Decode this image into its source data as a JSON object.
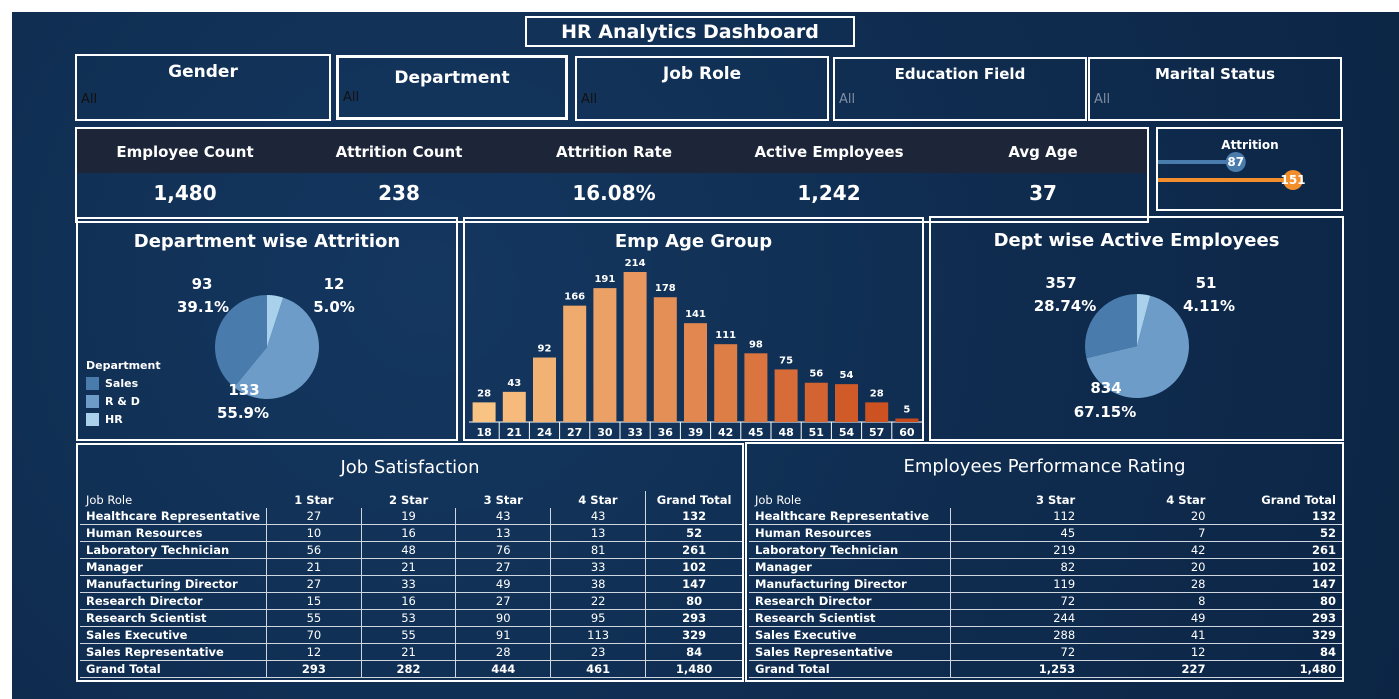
{
  "title": "HR Analytics Dashboard",
  "filters": [
    {
      "label": "Gender",
      "value": "All"
    },
    {
      "label": "Department",
      "value": "All"
    },
    {
      "label": "Job Role",
      "value": "All"
    },
    {
      "label": "Education Field",
      "value": "All"
    },
    {
      "label": "Marital Status",
      "value": "All"
    }
  ],
  "kpis": [
    {
      "label": "Employee Count",
      "value": "1,480"
    },
    {
      "label": "Attrition Count",
      "value": "238"
    },
    {
      "label": "Attrition Rate",
      "value": "16.08%"
    },
    {
      "label": "Active Employees",
      "value": "1,242"
    },
    {
      "label": "Avg Age",
      "value": "37"
    }
  ],
  "colors": {
    "sales": "#4a7bad",
    "rd": "#6d9cc9",
    "hr": "#a9d1ec",
    "attr_blue": "#4a7bad",
    "attr_orange": "#f28e2b",
    "bar_light": "#f9c483",
    "bar_dark": "#c9491a"
  },
  "chart_data": [
    {
      "type": "bar",
      "title": "Attrition",
      "categories": [
        "",
        ""
      ],
      "values": [
        87,
        151
      ],
      "value_labels": [
        "87",
        "151"
      ],
      "xlim": [
        0,
        151
      ]
    },
    {
      "type": "pie",
      "title": "Department wise Attrition",
      "legend_title": "Department",
      "legend_position": "left",
      "categories": [
        "Sales",
        "R & D",
        "HR"
      ],
      "values": [
        93,
        133,
        12
      ],
      "percent_labels": [
        "39.1%",
        "55.9%",
        "5.0%"
      ]
    },
    {
      "type": "bar",
      "title": "Emp Age Group",
      "categories": [
        "18",
        "21",
        "24",
        "27",
        "30",
        "33",
        "36",
        "39",
        "42",
        "45",
        "48",
        "51",
        "54",
        "57",
        "60"
      ],
      "values": [
        28,
        43,
        92,
        166,
        191,
        214,
        178,
        141,
        111,
        98,
        75,
        56,
        54,
        28,
        5
      ],
      "ylim": [
        0,
        214
      ]
    },
    {
      "type": "pie",
      "title": "Dept wise Active Employees",
      "categories": [
        "Sales",
        "R & D",
        "HR"
      ],
      "values": [
        357,
        834,
        51
      ],
      "percent_labels": [
        "28.74%",
        "67.15%",
        "4.11%"
      ]
    }
  ],
  "attrition_labels": {
    "v87": "87",
    "v151": "151"
  },
  "age_bar_labels": [
    "28",
    "43",
    "92",
    "166",
    "191",
    "214",
    "178",
    "141",
    "111",
    "98",
    "75",
    "56",
    "54",
    "28",
    "5"
  ],
  "dept_attrition_labels": {
    "sales_v": "93",
    "sales_p": "39.1%",
    "hr_v": "12",
    "hr_p": "5.0%",
    "rd_v": "133",
    "rd_p": "55.9%"
  },
  "legend_items": [
    "Sales",
    "R & D",
    "HR"
  ],
  "active_labels": {
    "sales_v": "357",
    "sales_p": "28.74%",
    "hr_v": "51",
    "hr_p": "4.11%",
    "rd_v": "834",
    "rd_p": "67.15%"
  },
  "job_satisfaction": {
    "title": "Job Satisfaction",
    "headers": [
      "Job Role",
      "1 Star",
      "2 Star",
      "3 Star",
      "4 Star",
      "Grand Total"
    ],
    "rows": [
      [
        "Healthcare Representative",
        "27",
        "19",
        "43",
        "43",
        "132"
      ],
      [
        "Human Resources",
        "10",
        "16",
        "13",
        "13",
        "52"
      ],
      [
        "Laboratory Technician",
        "56",
        "48",
        "76",
        "81",
        "261"
      ],
      [
        "Manager",
        "21",
        "21",
        "27",
        "33",
        "102"
      ],
      [
        "Manufacturing Director",
        "27",
        "33",
        "49",
        "38",
        "147"
      ],
      [
        "Research Director",
        "15",
        "16",
        "27",
        "22",
        "80"
      ],
      [
        "Research Scientist",
        "55",
        "53",
        "90",
        "95",
        "293"
      ],
      [
        "Sales Executive",
        "70",
        "55",
        "91",
        "113",
        "329"
      ],
      [
        "Sales Representative",
        "12",
        "21",
        "28",
        "23",
        "84"
      ]
    ],
    "total": [
      "Grand Total",
      "293",
      "282",
      "444",
      "461",
      "1,480"
    ]
  },
  "performance": {
    "title": "Employees Performance Rating",
    "headers": [
      "Job Role",
      "3 Star",
      "4 Star",
      "Grand Total"
    ],
    "rows": [
      [
        "Healthcare Representative",
        "112",
        "20",
        "132"
      ],
      [
        "Human Resources",
        "45",
        "7",
        "52"
      ],
      [
        "Laboratory Technician",
        "219",
        "42",
        "261"
      ],
      [
        "Manager",
        "82",
        "20",
        "102"
      ],
      [
        "Manufacturing Director",
        "119",
        "28",
        "147"
      ],
      [
        "Research Director",
        "72",
        "8",
        "80"
      ],
      [
        "Research Scientist",
        "244",
        "49",
        "293"
      ],
      [
        "Sales Executive",
        "288",
        "41",
        "329"
      ],
      [
        "Sales Representative",
        "72",
        "12",
        "84"
      ]
    ],
    "total": [
      "Grand Total",
      "1,253",
      "227",
      "1,480"
    ]
  }
}
